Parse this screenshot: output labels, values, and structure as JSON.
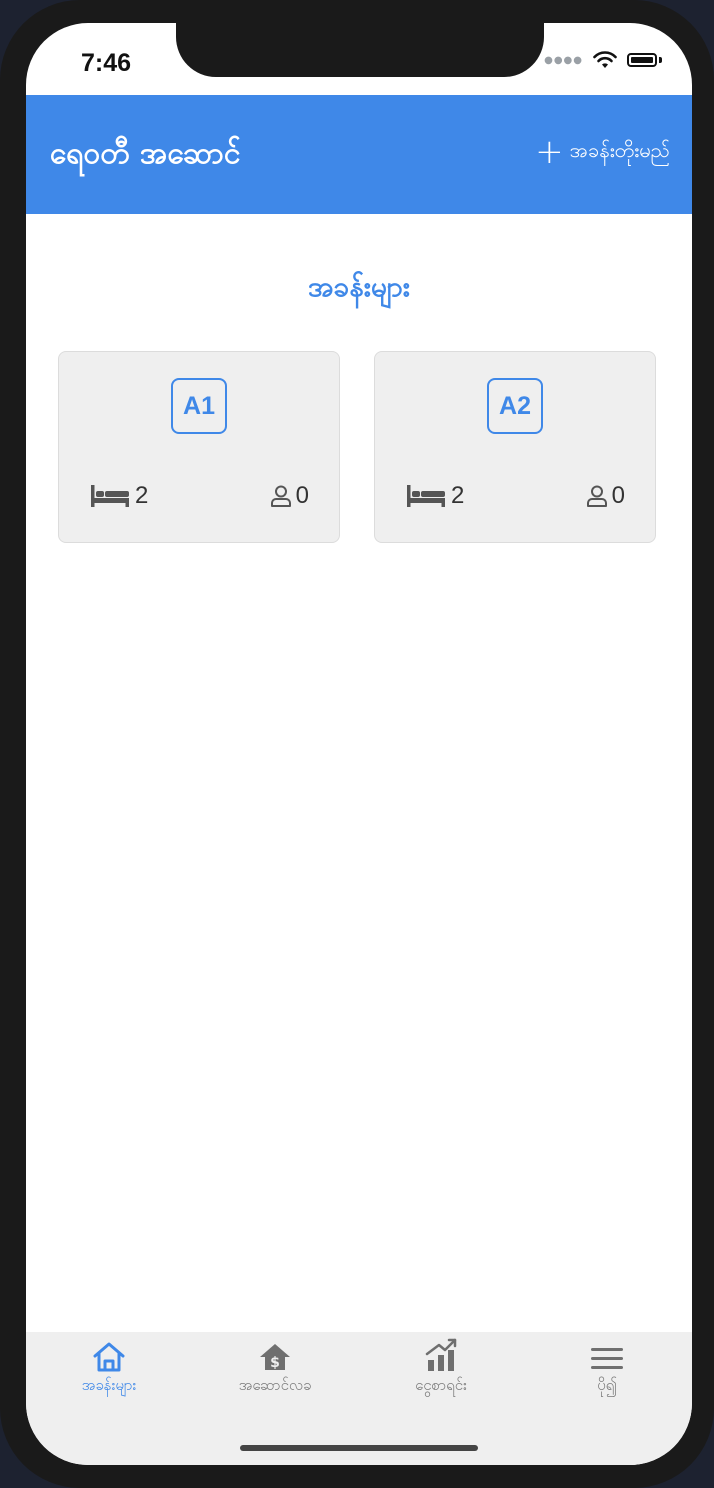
{
  "status": {
    "time": "7:46"
  },
  "header": {
    "title": "ရေဝတီ အဆောင်",
    "add_label": "အခန်းတိုးမည်",
    "add_icon": "plus-icon"
  },
  "section": {
    "title": "အခန်းများ"
  },
  "rooms": [
    {
      "name": "A1",
      "beds": "2",
      "people": "0"
    },
    {
      "name": "A2",
      "beds": "2",
      "people": "0"
    }
  ],
  "tabs": [
    {
      "label": "အခန်းများ",
      "icon": "home-icon",
      "active": true
    },
    {
      "label": "အဆောင်လခ",
      "icon": "house-dollar-icon",
      "active": false
    },
    {
      "label": "ငွေစာရင်း",
      "icon": "chart-icon",
      "active": false
    },
    {
      "label": "ပို၍",
      "icon": "menu-icon",
      "active": false
    }
  ],
  "colors": {
    "primary": "#3f88e8",
    "card_bg": "#efefef",
    "tab_bg": "#efefef"
  }
}
